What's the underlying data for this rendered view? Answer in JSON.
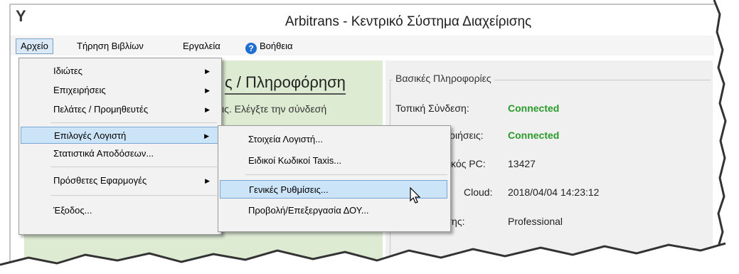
{
  "window": {
    "title": "Arbitrans - Κεντρικό Σύστημα Διαχείρισης"
  },
  "menubar": {
    "file": "Αρχείο",
    "books": "Τήρηση Βιβλίων",
    "tools": "Εργαλεία",
    "help": "Βοήθεια"
  },
  "left_pane": {
    "title_partial": "ς / Πληροφόρηση",
    "message_partial": "ις. Ελέγξτε την σύνδεσή"
  },
  "info_panel": {
    "title": "Βασικές Πληροφορίες",
    "rows": [
      {
        "label": "Τοπική Σύνδεση:",
        "value": "Connected"
      },
      {
        "label": "ριήσεις:",
        "value": "Connected"
      },
      {
        "label": "κός PC:",
        "value": "13427"
      },
      {
        "label": "Cloud:",
        "value": "2018/04/04 14:23:12"
      },
      {
        "label": "Ειδος Εκδοσης:",
        "value": "Professional"
      }
    ]
  },
  "file_menu": {
    "items": [
      {
        "label": "Ιδιώτες",
        "submenu": true
      },
      {
        "label": "Επιχειρήσεις",
        "submenu": true
      },
      {
        "label": "Πελάτες / Προμηθευτές",
        "submenu": true
      },
      {
        "label": "Επιλογές Λογιστή",
        "submenu": true
      },
      {
        "label": "Στατιστικά Αποδόσεων..."
      },
      {
        "label": "Πρόσθετες Εφαρμογές",
        "submenu": true
      },
      {
        "label": "Έξοδος..."
      }
    ]
  },
  "accountant_submenu": {
    "items": [
      {
        "label": "Στοιχεία Λογιστή..."
      },
      {
        "label": "Ειδικοί Κωδικοί Taxis..."
      },
      {
        "label": "Γενικές Ρυθμίσεις..."
      },
      {
        "label": "Προβολή/Επεξεργασία ΔΟΥ..."
      }
    ]
  },
  "colors": {
    "highlight": "#cce4f7",
    "connected": "#2a9a2a",
    "left_pane_bg": "#ddebd3"
  }
}
